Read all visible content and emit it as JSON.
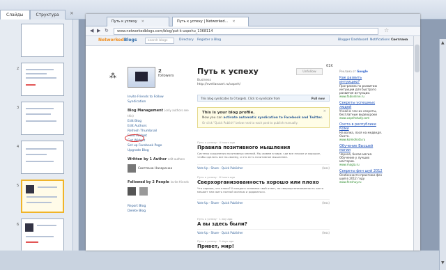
{
  "panel_tabs": [
    {
      "label": "Слайды"
    },
    {
      "label": "Структура"
    }
  ],
  "panel_close": "×",
  "thumbnails": [
    {
      "num": "",
      "sel": false
    },
    {
      "num": "2",
      "sel": false
    },
    {
      "num": "3",
      "sel": false
    },
    {
      "num": "4",
      "sel": false
    },
    {
      "num": "5",
      "sel": true
    },
    {
      "num": "6",
      "sel": false
    }
  ],
  "browser": {
    "tabs": [
      {
        "label": "Путь к успеху"
      },
      {
        "label": "Путь к успеху | Networked..."
      }
    ],
    "url": "www.networkedblogs.com/blog/put-k-uspehu_1368114",
    "nav_back": "◀",
    "nav_fwd": "▶",
    "nav_reload": "↻",
    "star": "☆"
  },
  "site": {
    "logo_main": "Networked",
    "logo_accent": "Blogs",
    "search_placeholder": "search blogs",
    "links": [
      "Directory",
      "Register a Blog"
    ],
    "right_links": [
      "Blogger Dashboard",
      "Notifications",
      "Светлана"
    ]
  },
  "blog": {
    "followers_count": "2",
    "followers_label": "followers",
    "title": "Путь к успеху",
    "subtitle": "Business",
    "url": "http://svetlanaart.ru/uspeh/",
    "unfollow_label": "Unfollow",
    "like_count": "61K",
    "feed_info": "This blog syndicates to 0 targets. Click to syndicate from",
    "pull_now": "Pull now"
  },
  "sidebar": {
    "links_top": [
      "Invite Friends to Follow",
      "Syndication"
    ],
    "mgmt_header": "Blog Management",
    "mgmt_note": "(only authors see this)",
    "mgmt_links": [
      "Edit Blog",
      "Edit Authors",
      "Refresh Thumbnail",
      "Feed Widget",
      "Get Widget",
      "Set up Facebook Page",
      "Upgrade Blog"
    ],
    "authors_header": "Written by 1 Author",
    "authors_note": "edit authors",
    "author_name": "Светлана Назаренко",
    "followers_header": "Followed by 2 People",
    "followers_note": "invite friends",
    "bottom_links": [
      "Report Blog",
      "Delete Blog"
    ]
  },
  "profile_box": {
    "heading": "This is your blog profile.",
    "text_prefix": "Now you can",
    "text_link": "activate automatic syndication to Facebook and Twitter.",
    "note": "Or click \"Quick Publish\" below next to each post to publish manually.",
    "close": "×"
  },
  "posts": [
    {
      "meta": "Путь к успеху · 4 hours ago",
      "title": "Правила позитивного мышления",
      "body": "Система сохранения позитивных мнений. Мы живем в мире, где все плохое и хорошое, чтобы сделать все по-своему, и это есть позитивное мышление.",
      "actions": "Vote Up · Share · Quick Publisher",
      "details": "(less)"
    },
    {
      "meta": "Путь к успеху · 6 hours ago",
      "title": "Сверхорганизованность хорошо или плохо",
      "body": "Что хорошо, что плохо? У каждого человека свой ответ, но сверхорганизованность часто мешает нам жить полной жизнью и радоваться.",
      "actions": "Vote Up · Share · Quick Publisher",
      "details": "(less)"
    },
    {
      "meta": "Путь к успеху · 1 day ago",
      "title": "А вы здесь были?",
      "body": "Необычные места нашей планеты, которые стоит посетить хотя бы раз в жизни.",
      "actions": "Vote Up · Share · Quick Publisher",
      "details": "(less)"
    },
    {
      "meta": "Путь к успеху · 2 days ago",
      "title": "Привет, мир!",
      "body": "",
      "actions": "",
      "details": ""
    }
  ],
  "ads": {
    "by": "Реклама от",
    "google": "Google",
    "items": [
      {
        "title": "Как развить интуицию?",
        "body": "Программа по развитию интуиции для быстрого развития интуиции.",
        "url": "www.fabionline.ru"
      },
      {
        "title": "Секреты успешных людей",
        "body": "Узнай в чем их секреты, бесплатные видеоуроки",
        "url": "www.uspehstudy.com"
      },
      {
        "title": "Охота в республике Коми",
        "body": "На волка, лося на медведя. Охота.",
        "url": "www.komiohota.ru"
      },
      {
        "title": "Обучение Высшей магии",
        "body": "Черная, белая магия. Обучение у лучших мастеров.",
        "url": "www.magia.ru"
      },
      {
        "title": "Секреты фен шуй 2012",
        "body": "Особенности практики фен шуй в 2012 году",
        "url": "www.fenshuy.ru"
      }
    ]
  }
}
